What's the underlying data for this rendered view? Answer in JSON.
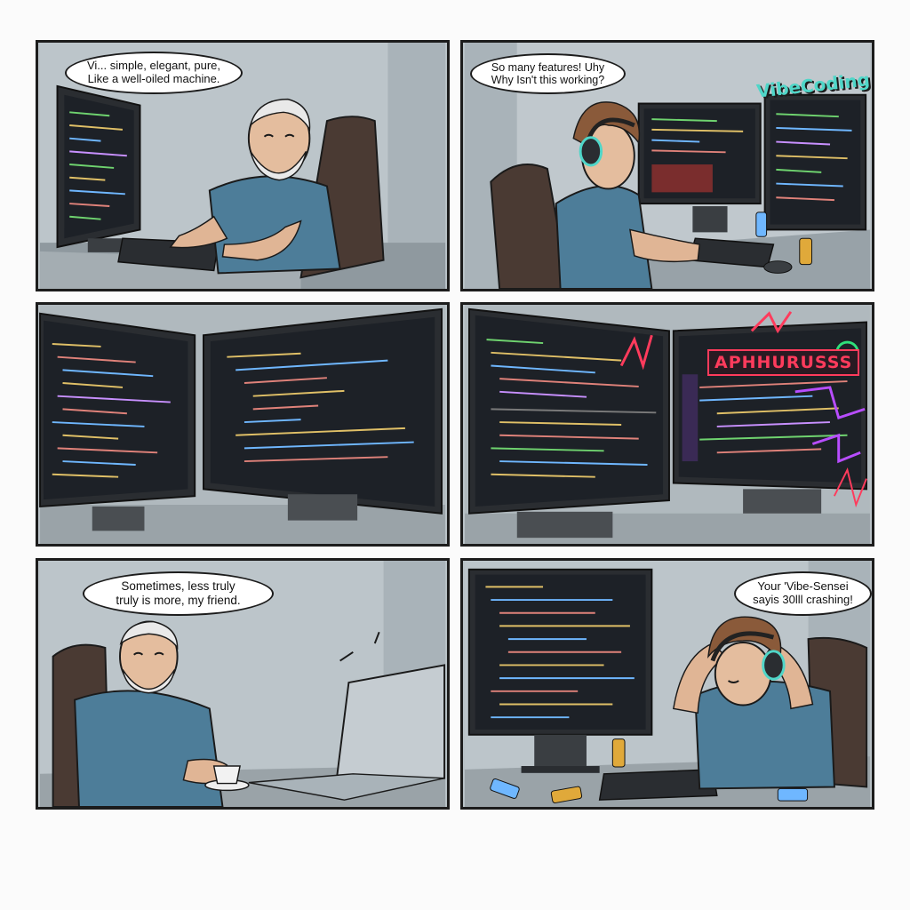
{
  "panels": [
    {
      "id": "panel-1",
      "speech": {
        "line1": "Vi... simple, elegant, pure,",
        "line2": "Like a well-oiled machine."
      }
    },
    {
      "id": "panel-2",
      "speech": {
        "line1": "So many features! Uhy",
        "line2": "Why Isn't this working?"
      },
      "wall_logo": "VibeCoding"
    },
    {
      "id": "panel-3"
    },
    {
      "id": "panel-4",
      "neon_sign": "APHHURUSSS"
    },
    {
      "id": "panel-5",
      "speech": {
        "line1": "Sometimes, less truly",
        "line2": "truly is more, my friend."
      }
    },
    {
      "id": "panel-6",
      "speech": {
        "line1": "Your 'Vibe-Sensei",
        "line2": "sayis 30lll crashing!"
      }
    }
  ],
  "colors": {
    "panel_border": "#1c1c1c",
    "wall": "#b9c2c7",
    "screen": "#1d2127",
    "shirt": "#4d7d99",
    "neon_red": "#ff3b5c",
    "neon_purple": "#b84dff",
    "logo_teal": "#4fd6c8"
  }
}
